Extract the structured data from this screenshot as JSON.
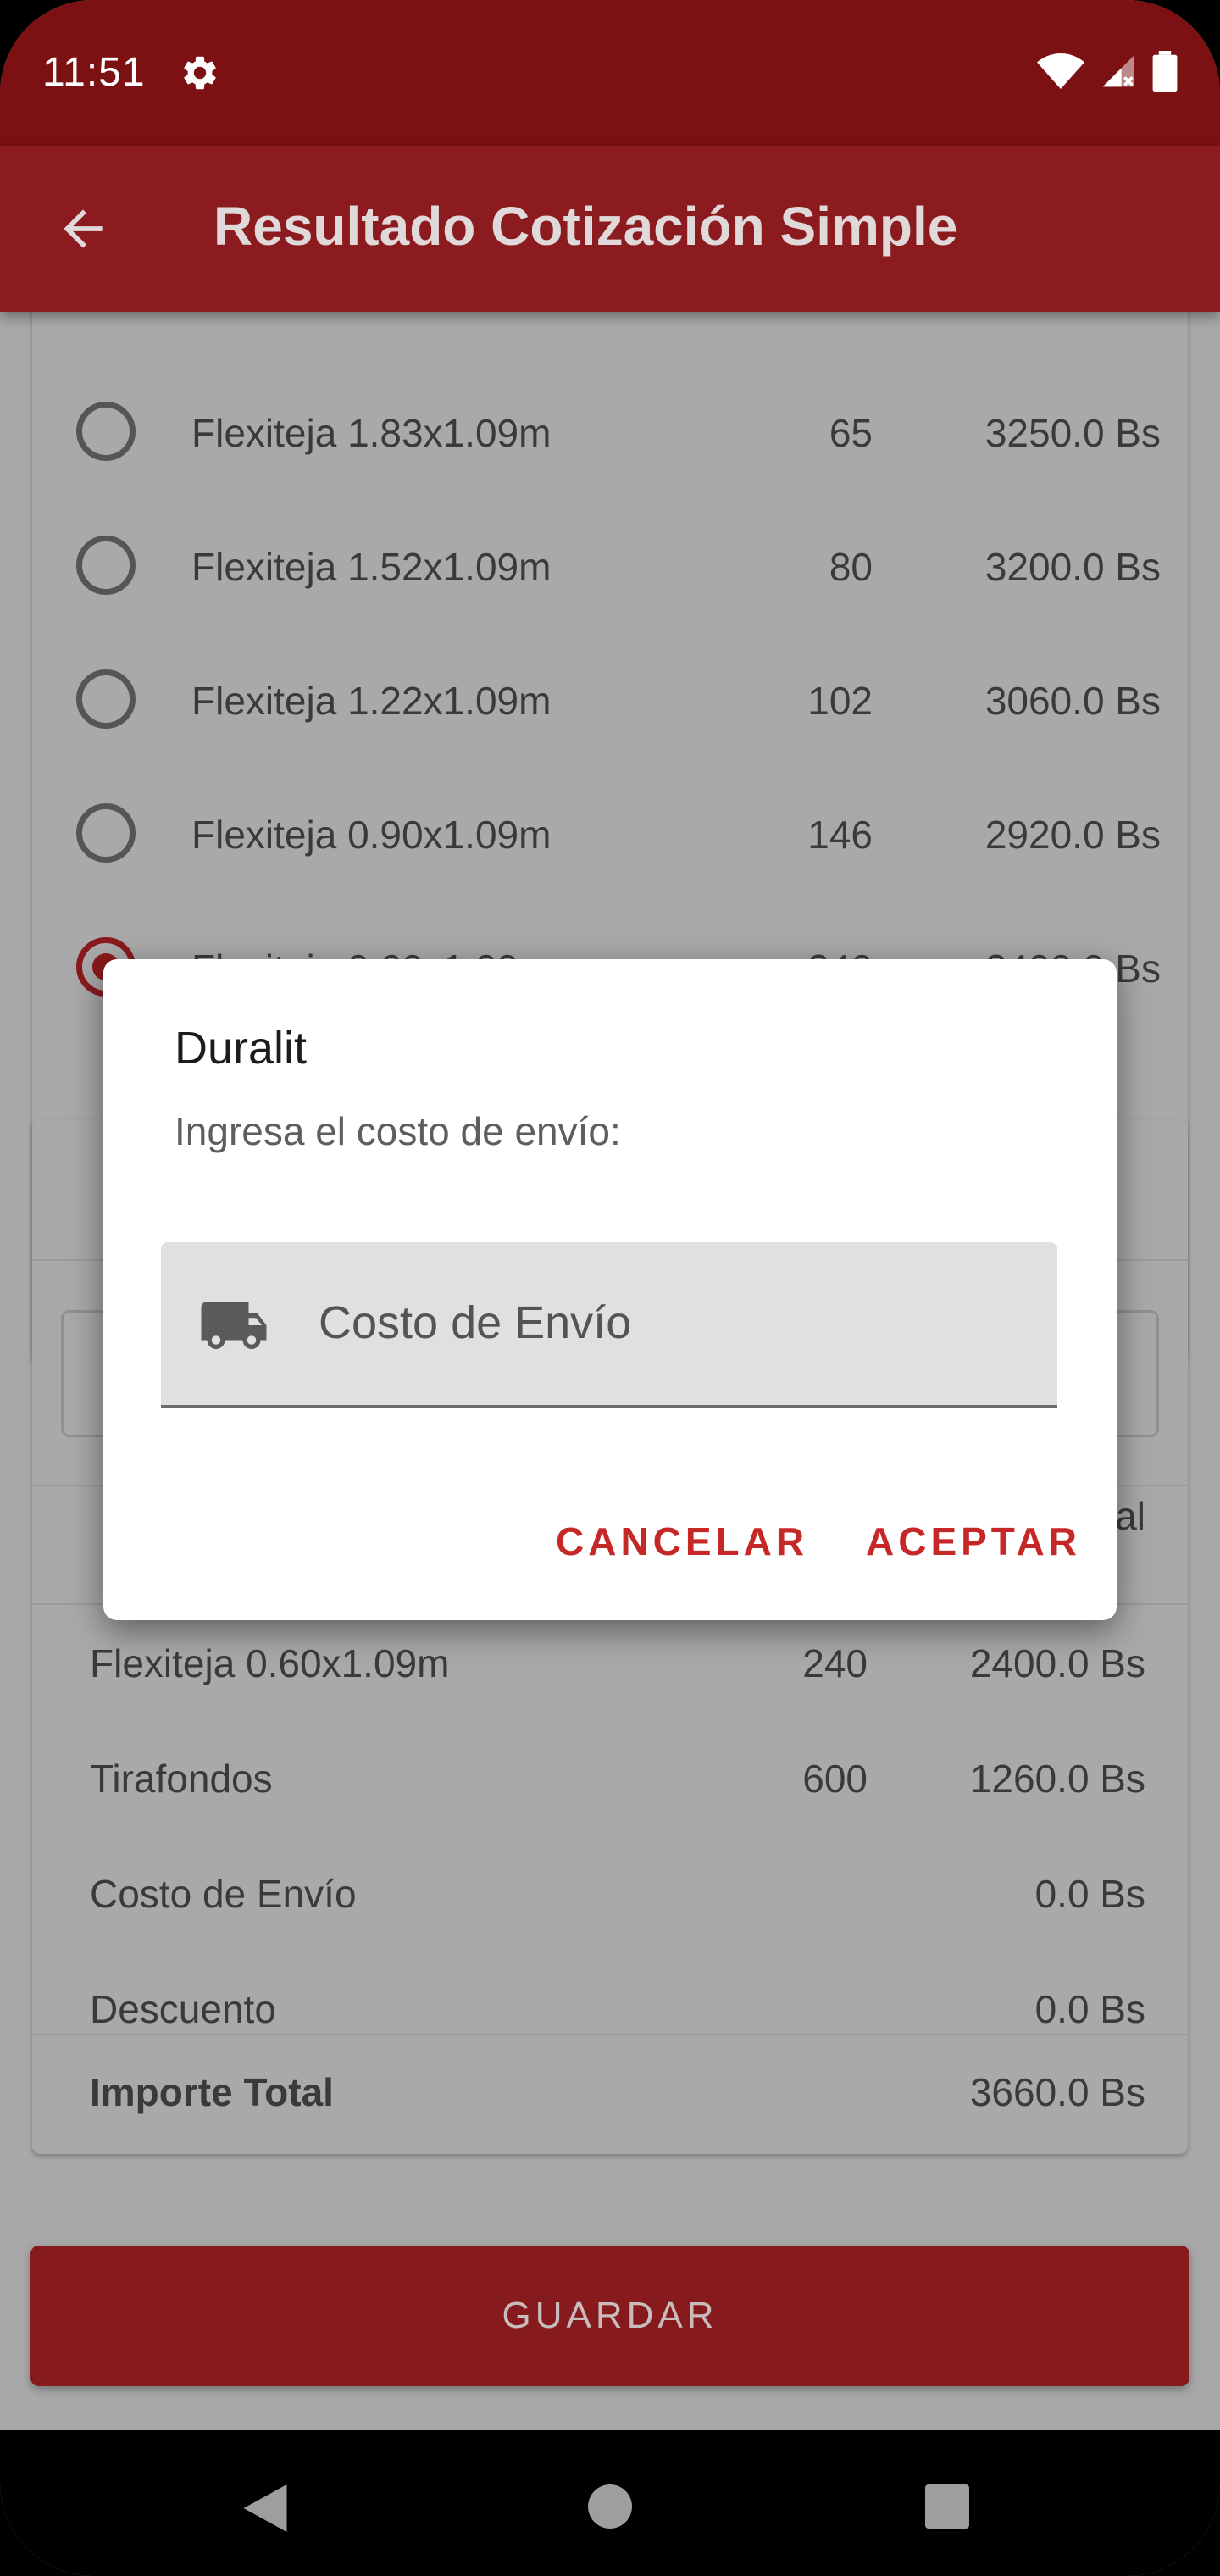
{
  "status_bar": {
    "time": "11:51"
  },
  "app_bar": {
    "title": "Resultado Cotización Simple"
  },
  "options": [
    {
      "name": "Flexiteja 1.83x1.09m",
      "qty": "65",
      "price": "3250.0 Bs",
      "selected": false
    },
    {
      "name": "Flexiteja 1.52x1.09m",
      "qty": "80",
      "price": "3200.0 Bs",
      "selected": false
    },
    {
      "name": "Flexiteja 1.22x1.09m",
      "qty": "102",
      "price": "3060.0 Bs",
      "selected": false
    },
    {
      "name": "Flexiteja 0.90x1.09m",
      "qty": "146",
      "price": "2920.0 Bs",
      "selected": false
    },
    {
      "name": "Flexiteja 0.60x1.09m",
      "qty": "240",
      "price": "2400.0 Bs",
      "selected": true
    }
  ],
  "summary": {
    "header_fragment": "al",
    "rows": [
      {
        "name": "Flexiteja 0.60x1.09m",
        "qty": "240",
        "value": "2400.0 Bs"
      },
      {
        "name": "Tirafondos",
        "qty": "600",
        "value": "1260.0 Bs"
      },
      {
        "name": "Costo de Envío",
        "qty": "",
        "value": "0.0 Bs"
      },
      {
        "name": "Descuento",
        "qty": "",
        "value": "0.0 Bs"
      }
    ],
    "total_label": "Importe Total",
    "total_value": "3660.0 Bs"
  },
  "save_button": "GUARDAR",
  "dialog": {
    "title": "Duralit",
    "message": "Ingresa el costo de envío:",
    "input_placeholder": "Costo de Envío",
    "icon": "truck-icon",
    "cancel": "CANCELAR",
    "accept": "ACEPTAR"
  },
  "colors": {
    "status_bar": "#7b1113",
    "app_bar": "#8b1b1f",
    "accent": "#c62828",
    "save_button": "#861a1d"
  }
}
